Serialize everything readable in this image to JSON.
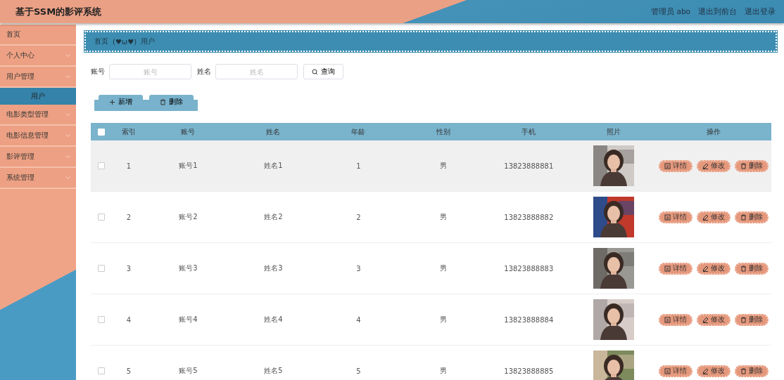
{
  "header": {
    "title": "基于SSM的影评系统",
    "links": [
      "管理员 abo",
      "退出到前台",
      "退出登录"
    ]
  },
  "sidebar": {
    "items": [
      {
        "label": "首页",
        "kind": "link"
      },
      {
        "label": "个人中心",
        "kind": "group"
      },
      {
        "label": "用户管理",
        "kind": "group",
        "children": [
          {
            "label": "用户",
            "selected": true
          }
        ]
      },
      {
        "label": "电影类型管理",
        "kind": "group"
      },
      {
        "label": "电影信息管理",
        "kind": "group"
      },
      {
        "label": "影评管理",
        "kind": "group"
      },
      {
        "label": "系统管理",
        "kind": "group"
      }
    ]
  },
  "breadcrumb": {
    "home": "首页",
    "separator": "(♥ω♥)",
    "current": "用户"
  },
  "search": {
    "fields": [
      {
        "label": "账号",
        "placeholder": "账号"
      },
      {
        "label": "姓名",
        "placeholder": "姓名"
      }
    ],
    "button": "查询"
  },
  "actions": [
    {
      "label": "新增",
      "kind": "add"
    },
    {
      "label": "删除",
      "kind": "delete"
    }
  ],
  "table": {
    "select_all": false,
    "columns": [
      "索引",
      "账号",
      "姓名",
      "年龄",
      "性别",
      "手机",
      "照片",
      "操作"
    ],
    "rows": [
      {
        "checked": false,
        "highlighted": true,
        "cells": [
          "1",
          "账号1",
          "姓名1",
          "1",
          "男",
          "13823888881"
        ],
        "photo": {
          "kind": "picture"
        },
        "buttons": [
          {
            "label": "详情",
            "kind": "detail"
          },
          {
            "label": "修改",
            "kind": "edit"
          },
          {
            "label": "删除",
            "kind": "delete"
          }
        ]
      },
      {
        "checked": false,
        "highlighted": false,
        "cells": [
          "2",
          "账号2",
          "姓名2",
          "2",
          "男",
          "13823888882"
        ],
        "photo": {
          "kind": "picture"
        },
        "buttons": [
          {
            "label": "详情",
            "kind": "detail"
          },
          {
            "label": "修改",
            "kind": "edit"
          },
          {
            "label": "删除",
            "kind": "delete"
          }
        ]
      },
      {
        "checked": false,
        "highlighted": false,
        "cells": [
          "3",
          "账号3",
          "姓名3",
          "3",
          "男",
          "13823888883"
        ],
        "photo": {
          "kind": "picture"
        },
        "buttons": [
          {
            "label": "详情",
            "kind": "detail"
          },
          {
            "label": "修改",
            "kind": "edit"
          },
          {
            "label": "删除",
            "kind": "delete"
          }
        ]
      },
      {
        "checked": false,
        "highlighted": false,
        "cells": [
          "4",
          "账号4",
          "姓名4",
          "4",
          "男",
          "13823888884"
        ],
        "photo": {
          "kind": "picture"
        },
        "buttons": [
          {
            "label": "详情",
            "kind": "detail"
          },
          {
            "label": "修改",
            "kind": "edit"
          },
          {
            "label": "删除",
            "kind": "delete"
          }
        ]
      },
      {
        "checked": false,
        "highlighted": false,
        "cells": [
          "5",
          "账号5",
          "姓名5",
          "5",
          "男",
          "13823888885"
        ],
        "photo": {
          "kind": "picture"
        },
        "buttons": [
          {
            "label": "详情",
            "kind": "detail"
          },
          {
            "label": "修改",
            "kind": "edit"
          },
          {
            "label": "删除",
            "kind": "delete"
          }
        ]
      }
    ]
  }
}
